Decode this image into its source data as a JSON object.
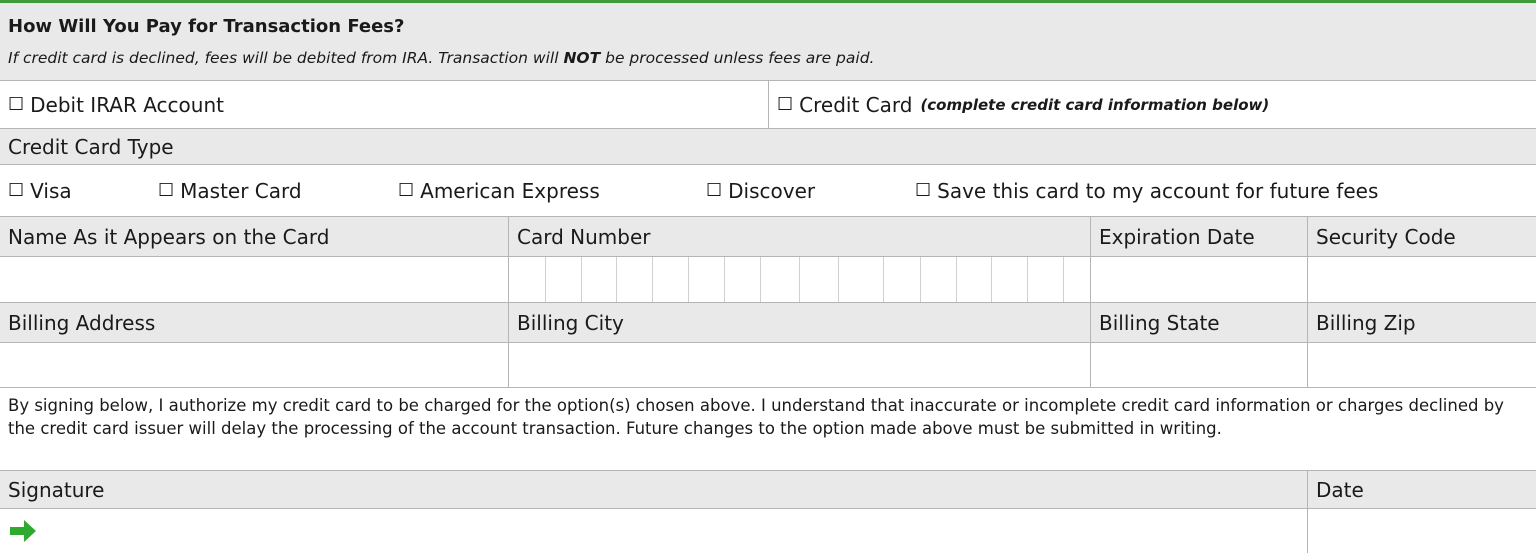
{
  "header": {
    "title": "How Will You Pay for Transaction Fees?",
    "note_pre": "If credit card is declined, fees will be debited from IRA. Transaction will ",
    "note_bold": "NOT",
    "note_post": " be processed unless fees are paid."
  },
  "payment_options": {
    "debit_label": "Debit IRAR Account",
    "credit_label": "Credit Card",
    "credit_note": "(complete credit card information below)"
  },
  "card_type": {
    "heading": "Credit Card Type",
    "options": [
      "Visa",
      "Master Card",
      "American Express",
      "Discover",
      "Save this card to my account for future fees"
    ]
  },
  "card_fields": {
    "name_label": "Name As it Appears on the Card",
    "number_label": "Card Number",
    "expiration_label": "Expiration Date",
    "security_label": "Security Code"
  },
  "billing_fields": {
    "address_label": "Billing Address",
    "city_label": "Billing City",
    "state_label": "Billing State",
    "zip_label": "Billing Zip"
  },
  "authorization": {
    "text": "By signing below, I authorize my credit card to be charged for the option(s) chosen above. I understand that inaccurate or incomplete credit card information or charges declined by the credit card issuer will delay the processing of the account transaction. Future changes to the option made above must be submitted in writing."
  },
  "signature": {
    "label": "Signature",
    "date_label": "Date"
  },
  "colors": {
    "accent_green": "#2eaa2e",
    "header_gray": "#e9e9e9"
  },
  "icons": {
    "checkbox": "empty-square",
    "signature_marker": "green-right-arrow"
  }
}
